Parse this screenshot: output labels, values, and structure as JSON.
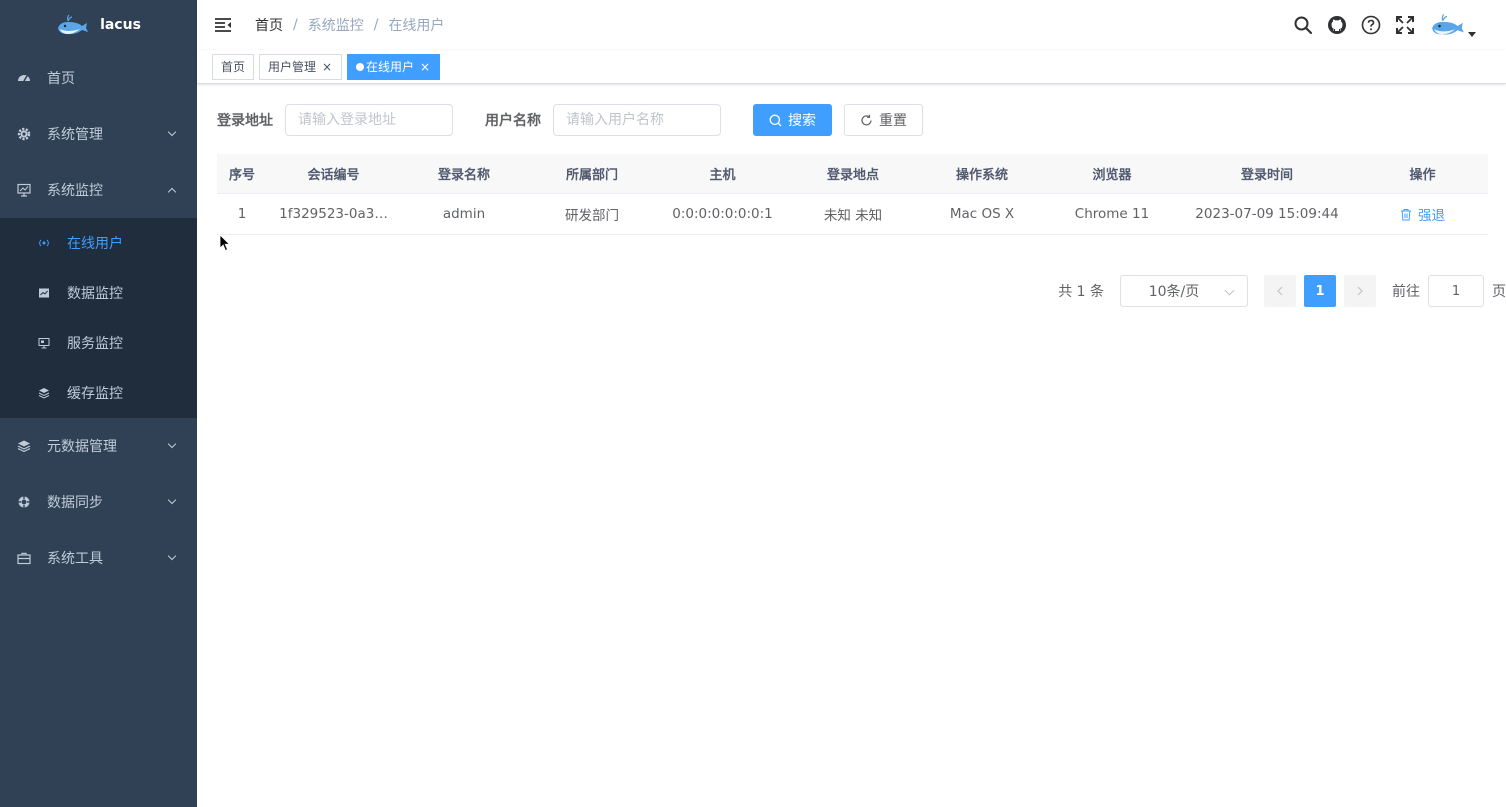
{
  "app": {
    "name": "lacus"
  },
  "sidebar": {
    "items": [
      {
        "label": "首页",
        "icon": "dashboard-icon"
      },
      {
        "label": "系统管理",
        "icon": "gear-icon"
      },
      {
        "label": "系统监控",
        "icon": "monitor-icon"
      },
      {
        "label": "元数据管理",
        "icon": "layers-icon"
      },
      {
        "label": "数据同步",
        "icon": "sync-icon"
      },
      {
        "label": "系统工具",
        "icon": "toolbox-icon"
      }
    ],
    "submenu": [
      {
        "label": "在线用户",
        "icon": "online-icon",
        "active": true
      },
      {
        "label": "数据监控",
        "icon": "data-monitor-icon"
      },
      {
        "label": "服务监控",
        "icon": "server-icon"
      },
      {
        "label": "缓存监控",
        "icon": "cache-icon"
      }
    ]
  },
  "breadcrumb": [
    "首页",
    "系统监控",
    "在线用户"
  ],
  "tags": [
    {
      "label": "首页"
    },
    {
      "label": "用户管理"
    },
    {
      "label": "在线用户",
      "active": true
    }
  ],
  "search": {
    "ipaddr_label": "登录地址",
    "ipaddr_placeholder": "请输入登录地址",
    "username_label": "用户名称",
    "username_placeholder": "请输入用户名称",
    "search_button": "搜索",
    "reset_button": "重置"
  },
  "table": {
    "headers": [
      "序号",
      "会话编号",
      "登录名称",
      "所属部门",
      "主机",
      "登录地点",
      "操作系统",
      "浏览器",
      "登录时间",
      "操作"
    ],
    "rows": [
      {
        "index": "1",
        "session_id": "1f329523-0a3…",
        "username": "admin",
        "dept": "研发部门",
        "host": "0:0:0:0:0:0:0:1",
        "location": "未知 未知",
        "os": "Mac OS X",
        "browser": "Chrome 11",
        "login_time": "2023-07-09 15:09:44",
        "action": "强退"
      }
    ]
  },
  "pagination": {
    "total": "共 1 条",
    "page_size": "10条/页",
    "current_page": "1",
    "goto_label": "前往",
    "goto_value": "1",
    "page_unit": "页"
  },
  "colors": {
    "primary": "#409eff",
    "sidebar": "#304156",
    "submenu": "#1f2d3d"
  }
}
